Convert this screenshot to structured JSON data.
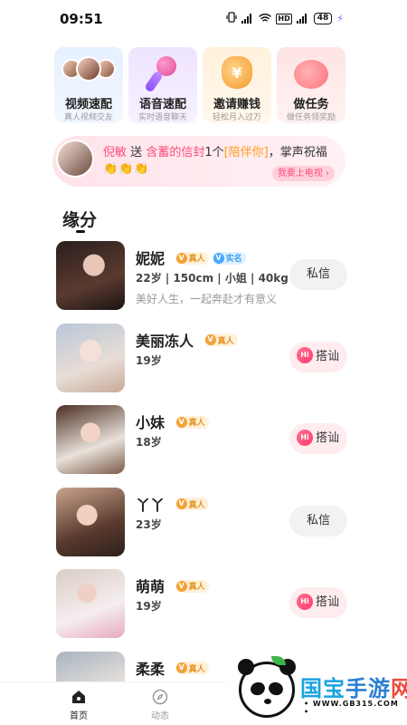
{
  "status_bar": {
    "time": "09:51",
    "hd_label": "HD",
    "battery": "48"
  },
  "features": [
    {
      "title": "视频速配",
      "subtitle": "真人视频交友",
      "icon": "avatars-icon"
    },
    {
      "title": "语音速配",
      "subtitle": "实时语音聊天",
      "icon": "microphone-icon"
    },
    {
      "title": "邀请赚钱",
      "subtitle": "轻松月入过万",
      "icon": "money-bag-icon"
    },
    {
      "title": "做任务",
      "subtitle": "做任务领奖励",
      "icon": "piggy-bank-icon"
    }
  ],
  "broadcast": {
    "sender": "倪敏",
    "verb": "送",
    "receiver": "含蓄的信封",
    "count": "1个",
    "gift": "[陪伴你]",
    "suffix": "，掌声祝福",
    "claps": "👏👏👏",
    "cta": "我要上电视 ›"
  },
  "section": {
    "title": "缘分"
  },
  "users": [
    {
      "name": "妮妮",
      "badge_real": "真人",
      "badge_extra": "实名",
      "meta": "22岁 | 150cm | 小姐 | 40kg",
      "bio": "美好人生，一起奔赴才有意义",
      "action": "私信",
      "action_type": "message"
    },
    {
      "name": "美丽冻人",
      "badge_real": "真人",
      "badge_extra": "",
      "meta": "19岁",
      "bio": "",
      "action": "搭讪",
      "action_type": "hi"
    },
    {
      "name": "小妹",
      "badge_real": "真人",
      "badge_extra": "",
      "meta": "18岁",
      "bio": "",
      "action": "搭讪",
      "action_type": "hi"
    },
    {
      "name": "丫丫",
      "badge_real": "真人",
      "badge_extra": "",
      "meta": "23岁",
      "bio": "",
      "action": "私信",
      "action_type": "message"
    },
    {
      "name": "萌萌",
      "badge_real": "真人",
      "badge_extra": "",
      "meta": "19岁",
      "bio": "",
      "action": "搭讪",
      "action_type": "hi"
    },
    {
      "name": "柔柔",
      "badge_real": "真人",
      "badge_extra": "",
      "meta": "",
      "bio": "",
      "action": "",
      "action_type": ""
    }
  ],
  "hi_icon_label": "Hi",
  "badge_icon_letter": "V",
  "bottom_nav": {
    "home": "首页",
    "feed": "动态"
  },
  "watermark": {
    "title_1": "国宝",
    "title_2": "手游",
    "title_3": "网",
    "url": "• WWW.GB315.COM •"
  },
  "colors": {
    "accent_pink": "#ff4d79",
    "gold": "#ff9b1b",
    "real_badge": "#f3a23a",
    "blue_badge": "#4aa8ff"
  }
}
